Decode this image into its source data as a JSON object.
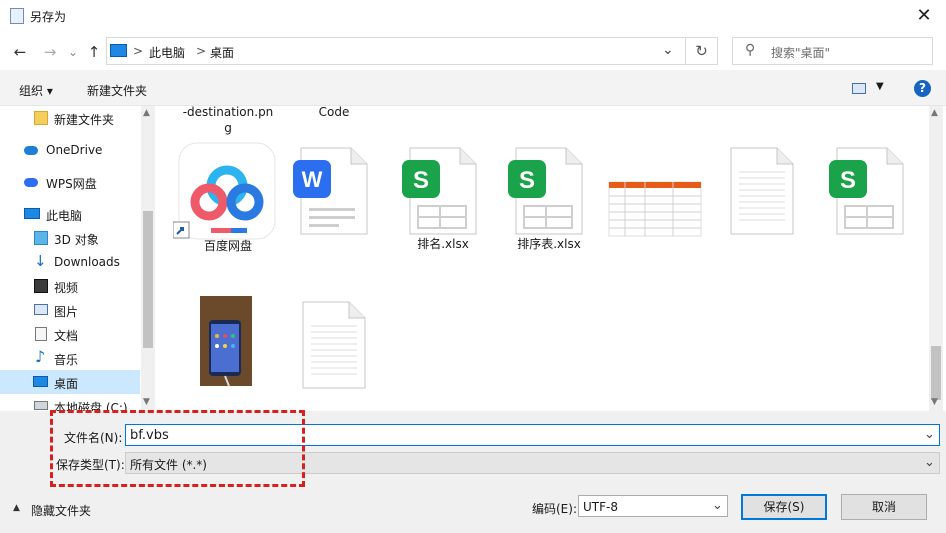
{
  "window": {
    "title": "另存为",
    "close": "✕"
  },
  "nav": {
    "back": "←",
    "forward": "→",
    "recent": "⌄",
    "up": "↑",
    "crumbs": [
      "此电脑",
      "桌面"
    ],
    "crumb_sep": ">",
    "refresh": "↻",
    "dropdown": "⌄",
    "search_placeholder": "搜索\"桌面\""
  },
  "toolbar": {
    "organize": "组织 ▾",
    "new_folder": "新建文件夹",
    "help": "?"
  },
  "sidebar": {
    "items": [
      {
        "label": "新建文件夹",
        "icon": "folder-icon"
      },
      {
        "label": "OneDrive",
        "icon": "cloud-icon"
      },
      {
        "label": "WPS网盘",
        "icon": "cloud-icon"
      },
      {
        "label": "此电脑",
        "icon": "computer-icon"
      },
      {
        "label": "3D 对象",
        "icon": "cube-icon"
      },
      {
        "label": "Downloads",
        "icon": "download-icon"
      },
      {
        "label": "视频",
        "icon": "video-icon"
      },
      {
        "label": "图片",
        "icon": "picture-icon"
      },
      {
        "label": "文档",
        "icon": "document-icon"
      },
      {
        "label": "音乐",
        "icon": "music-icon"
      },
      {
        "label": "桌面",
        "icon": "desktop-icon"
      },
      {
        "label": "本地磁盘 (C:)",
        "icon": "drive-icon"
      }
    ]
  },
  "files": {
    "top_partial": [
      "-destination.pn\ng",
      "Code"
    ],
    "row1": [
      {
        "name": "百度网盘",
        "kind": "baidu-shortcut"
      },
      {
        "name": "",
        "kind": "wps-writer"
      },
      {
        "name": "排名.xlsx",
        "kind": "wps-sheet"
      },
      {
        "name": "排序表.xlsx",
        "kind": "wps-sheet"
      },
      {
        "name": "",
        "kind": "table-thumbnail"
      },
      {
        "name": "",
        "kind": "blank-doc"
      },
      {
        "name": "",
        "kind": "wps-sheet"
      }
    ],
    "row2": [
      {
        "name": "",
        "kind": "phone-photo"
      },
      {
        "name": "",
        "kind": "blank-doc"
      }
    ]
  },
  "form": {
    "filename_label": "文件名(N):",
    "filename_value": "bf.vbs",
    "filetype_label": "保存类型(T):",
    "filetype_value": "所有文件  (*.*)",
    "hide_folders": "隐藏文件夹",
    "encoding_label": "编码(E):",
    "encoding_value": "UTF-8",
    "save": "保存(S)",
    "cancel": "取消"
  },
  "colors": {
    "accent": "#0078d7",
    "annotation": "#d92020",
    "wps_green": "#1aa34a",
    "wps_blue": "#2b6ff0"
  }
}
